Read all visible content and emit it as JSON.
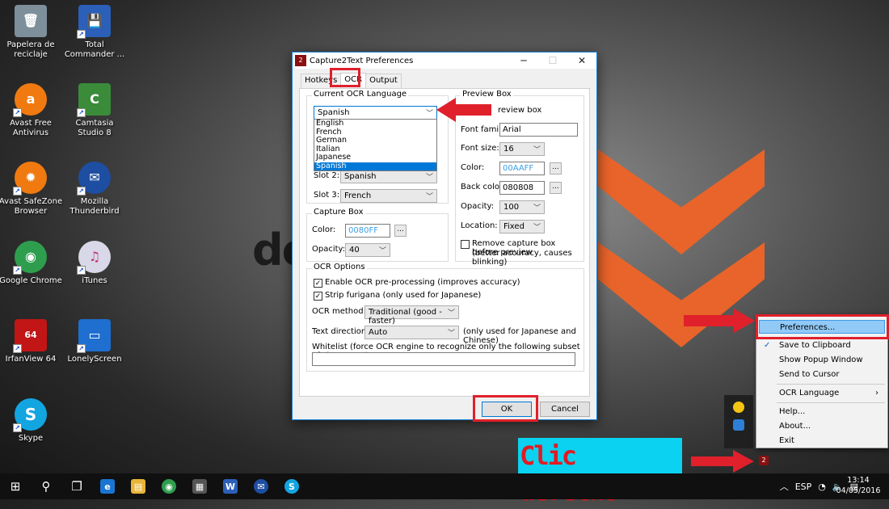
{
  "desktop": {
    "background_text": "dc",
    "icons": [
      {
        "label": "Papelera de reciclaje",
        "glyph": "🗑",
        "color": "#7e8f9c"
      },
      {
        "label": "Total Commander ...",
        "glyph": "💾",
        "color": "#2b5fb8"
      },
      {
        "label": "Avast Free Antivirus",
        "glyph": "a",
        "color": "#f07a10"
      },
      {
        "label": "Camtasia Studio 8",
        "glyph": "C",
        "color": "#3a8c3a"
      },
      {
        "label": "Avast SafeZone Browser",
        "glyph": "✹",
        "color": "#f07a10"
      },
      {
        "label": "Mozilla Thunderbird",
        "glyph": "✉",
        "color": "#1d4ea2"
      },
      {
        "label": "Google Chrome",
        "glyph": "◉",
        "color": "#2e9e4e"
      },
      {
        "label": "iTunes",
        "glyph": "♫",
        "color": "#d8d8e8"
      },
      {
        "label": "IrfanView 64",
        "glyph": "64",
        "color": "#c21616"
      },
      {
        "label": "LonelyScreen",
        "glyph": "▭",
        "color": "#1e6fd0"
      },
      {
        "label": "Skype",
        "glyph": "S",
        "color": "#12a5e0"
      }
    ]
  },
  "dialog": {
    "title": "Capture2Text Preferences",
    "tabs": [
      "Hotkeys",
      "OCR",
      "Output"
    ],
    "current_ocr_language": {
      "legend": "Current OCR Language",
      "selected": "Spanish",
      "options": [
        "English",
        "French",
        "German",
        "Italian",
        "Japanese",
        "Spanish"
      ],
      "highlighted": "Spanish",
      "slot2_label": "Slot 2:",
      "slot2_value": "Spanish",
      "slot3_label": "Slot 3:",
      "slot3_value": "French"
    },
    "capture_box": {
      "legend": "Capture Box",
      "color_label": "Color:",
      "color_value": "0080FF",
      "opacity_label": "Opacity:",
      "opacity_value": "40",
      "browse": "..."
    },
    "preview_box": {
      "legend": "Preview Box",
      "show_partial": "review box",
      "font_family_label": "Font family:",
      "font_family_value": "Arial",
      "font_size_label": "Font size:",
      "font_size_value": "16",
      "color_label": "Color:",
      "color_value": "00AAFF",
      "back_color_label": "Back color:",
      "back_color_value": "080808",
      "opacity_label": "Opacity:",
      "opacity_value": "100",
      "location_label": "Location:",
      "location_value": "Fixed",
      "remove_line1": "Remove capture box before preview",
      "remove_line2": "(better accuracy, causes blinking)",
      "browse": "..."
    },
    "ocr_options": {
      "legend": "OCR Options",
      "preprocess_label": "Enable OCR pre-processing (improves accuracy)",
      "furigana_label": "Strip furigana (only used for Japanese)",
      "method_label": "OCR method:",
      "method_value": "Traditional (good - faster)",
      "direction_label": "Text direction:",
      "direction_value": "Auto",
      "direction_note": "(only used for Japanese and Chinese)",
      "whitelist_label": "Whitelist (force OCR engine to recognize only the following subset of characters):",
      "whitelist_value": ""
    },
    "ok_label": "OK",
    "cancel_label": "Cancel",
    "checkmark": "✓"
  },
  "context_menu": {
    "items": [
      "Preferences...",
      "Save to Clipboard",
      "Show Popup Window",
      "Send to Cursor",
      "OCR Language",
      "Help...",
      "About...",
      "Exit"
    ],
    "submenu_arrow": "›",
    "check": "✓"
  },
  "callout": {
    "text": "Clic derecho"
  },
  "taskbar": {
    "tray_language": "ESP",
    "time": "13:14",
    "date": "04/05/2016"
  },
  "colors": {
    "accent": "#0078d7",
    "annotation_red": "#e0202b",
    "callout_bg": "#0ad2f0"
  }
}
